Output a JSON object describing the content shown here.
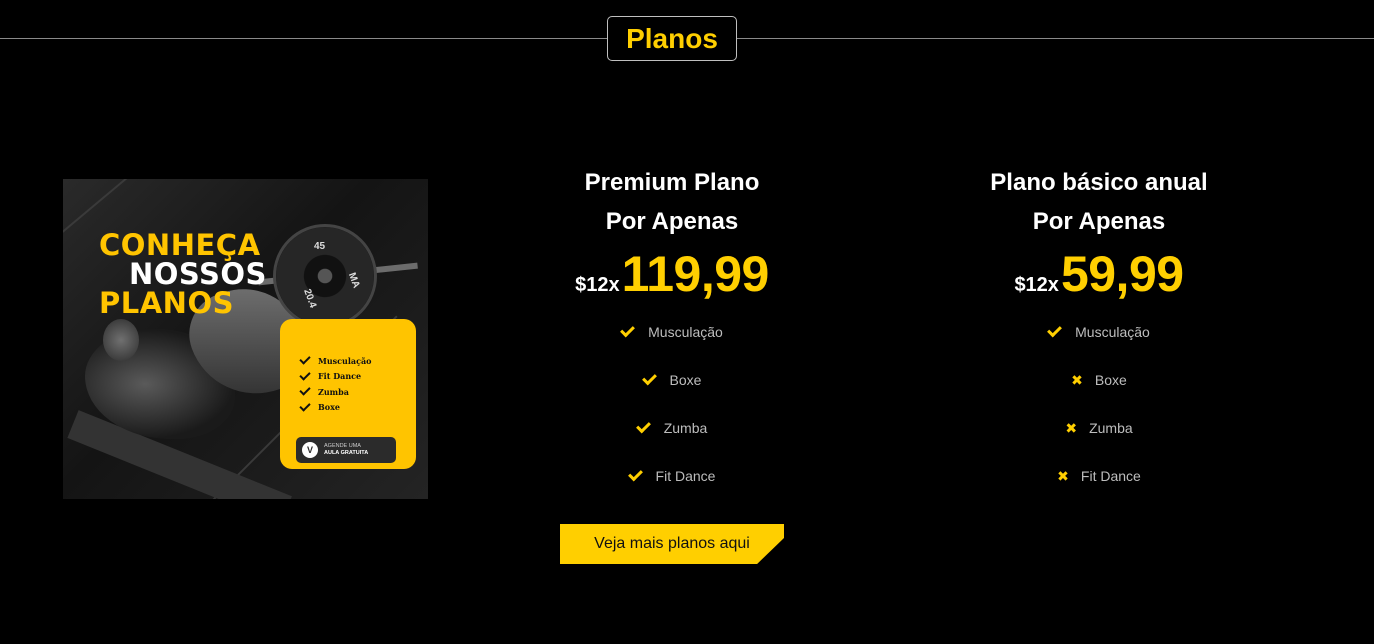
{
  "section": {
    "title": "Planos"
  },
  "promo": {
    "title_lines": [
      "CONHEÇA",
      "NOSSOS",
      "PLANOS"
    ],
    "plate_labels": [
      "45",
      "20.4",
      "MA"
    ],
    "list": [
      "Musculação",
      "Fit Dance",
      "Zumba",
      "Boxe"
    ],
    "cta_line1": "AGENDE UMA",
    "cta_line2": "AULA GRATUITA",
    "cta_icon": "V"
  },
  "plans": [
    {
      "name": "Premium Plano",
      "subtitle": "Por Apenas",
      "installments": "$12x",
      "price": "119,99",
      "features": [
        {
          "label": "Musculação",
          "icon": "check-icon"
        },
        {
          "label": "Boxe",
          "icon": "check-icon"
        },
        {
          "label": "Zumba",
          "icon": "check-icon"
        },
        {
          "label": "Fit Dance",
          "icon": "check-icon"
        }
      ]
    },
    {
      "name": "Plano básico anual",
      "subtitle": "Por Apenas",
      "installments": "$12x",
      "price": "59,99",
      "features": [
        {
          "label": "Musculação",
          "icon": "check-icon"
        },
        {
          "label": "Boxe",
          "icon": "cross-icon"
        },
        {
          "label": "Zumba",
          "icon": "cross-icon"
        },
        {
          "label": "Fit Dance",
          "icon": "cross-icon"
        }
      ]
    }
  ],
  "cta": {
    "label": "Veja mais planos aqui"
  },
  "colors": {
    "accent": "#ffcf00",
    "background": "#000000",
    "muted_text": "#bdbdbd"
  },
  "icons": {
    "check": "✔",
    "cross": "✖"
  }
}
